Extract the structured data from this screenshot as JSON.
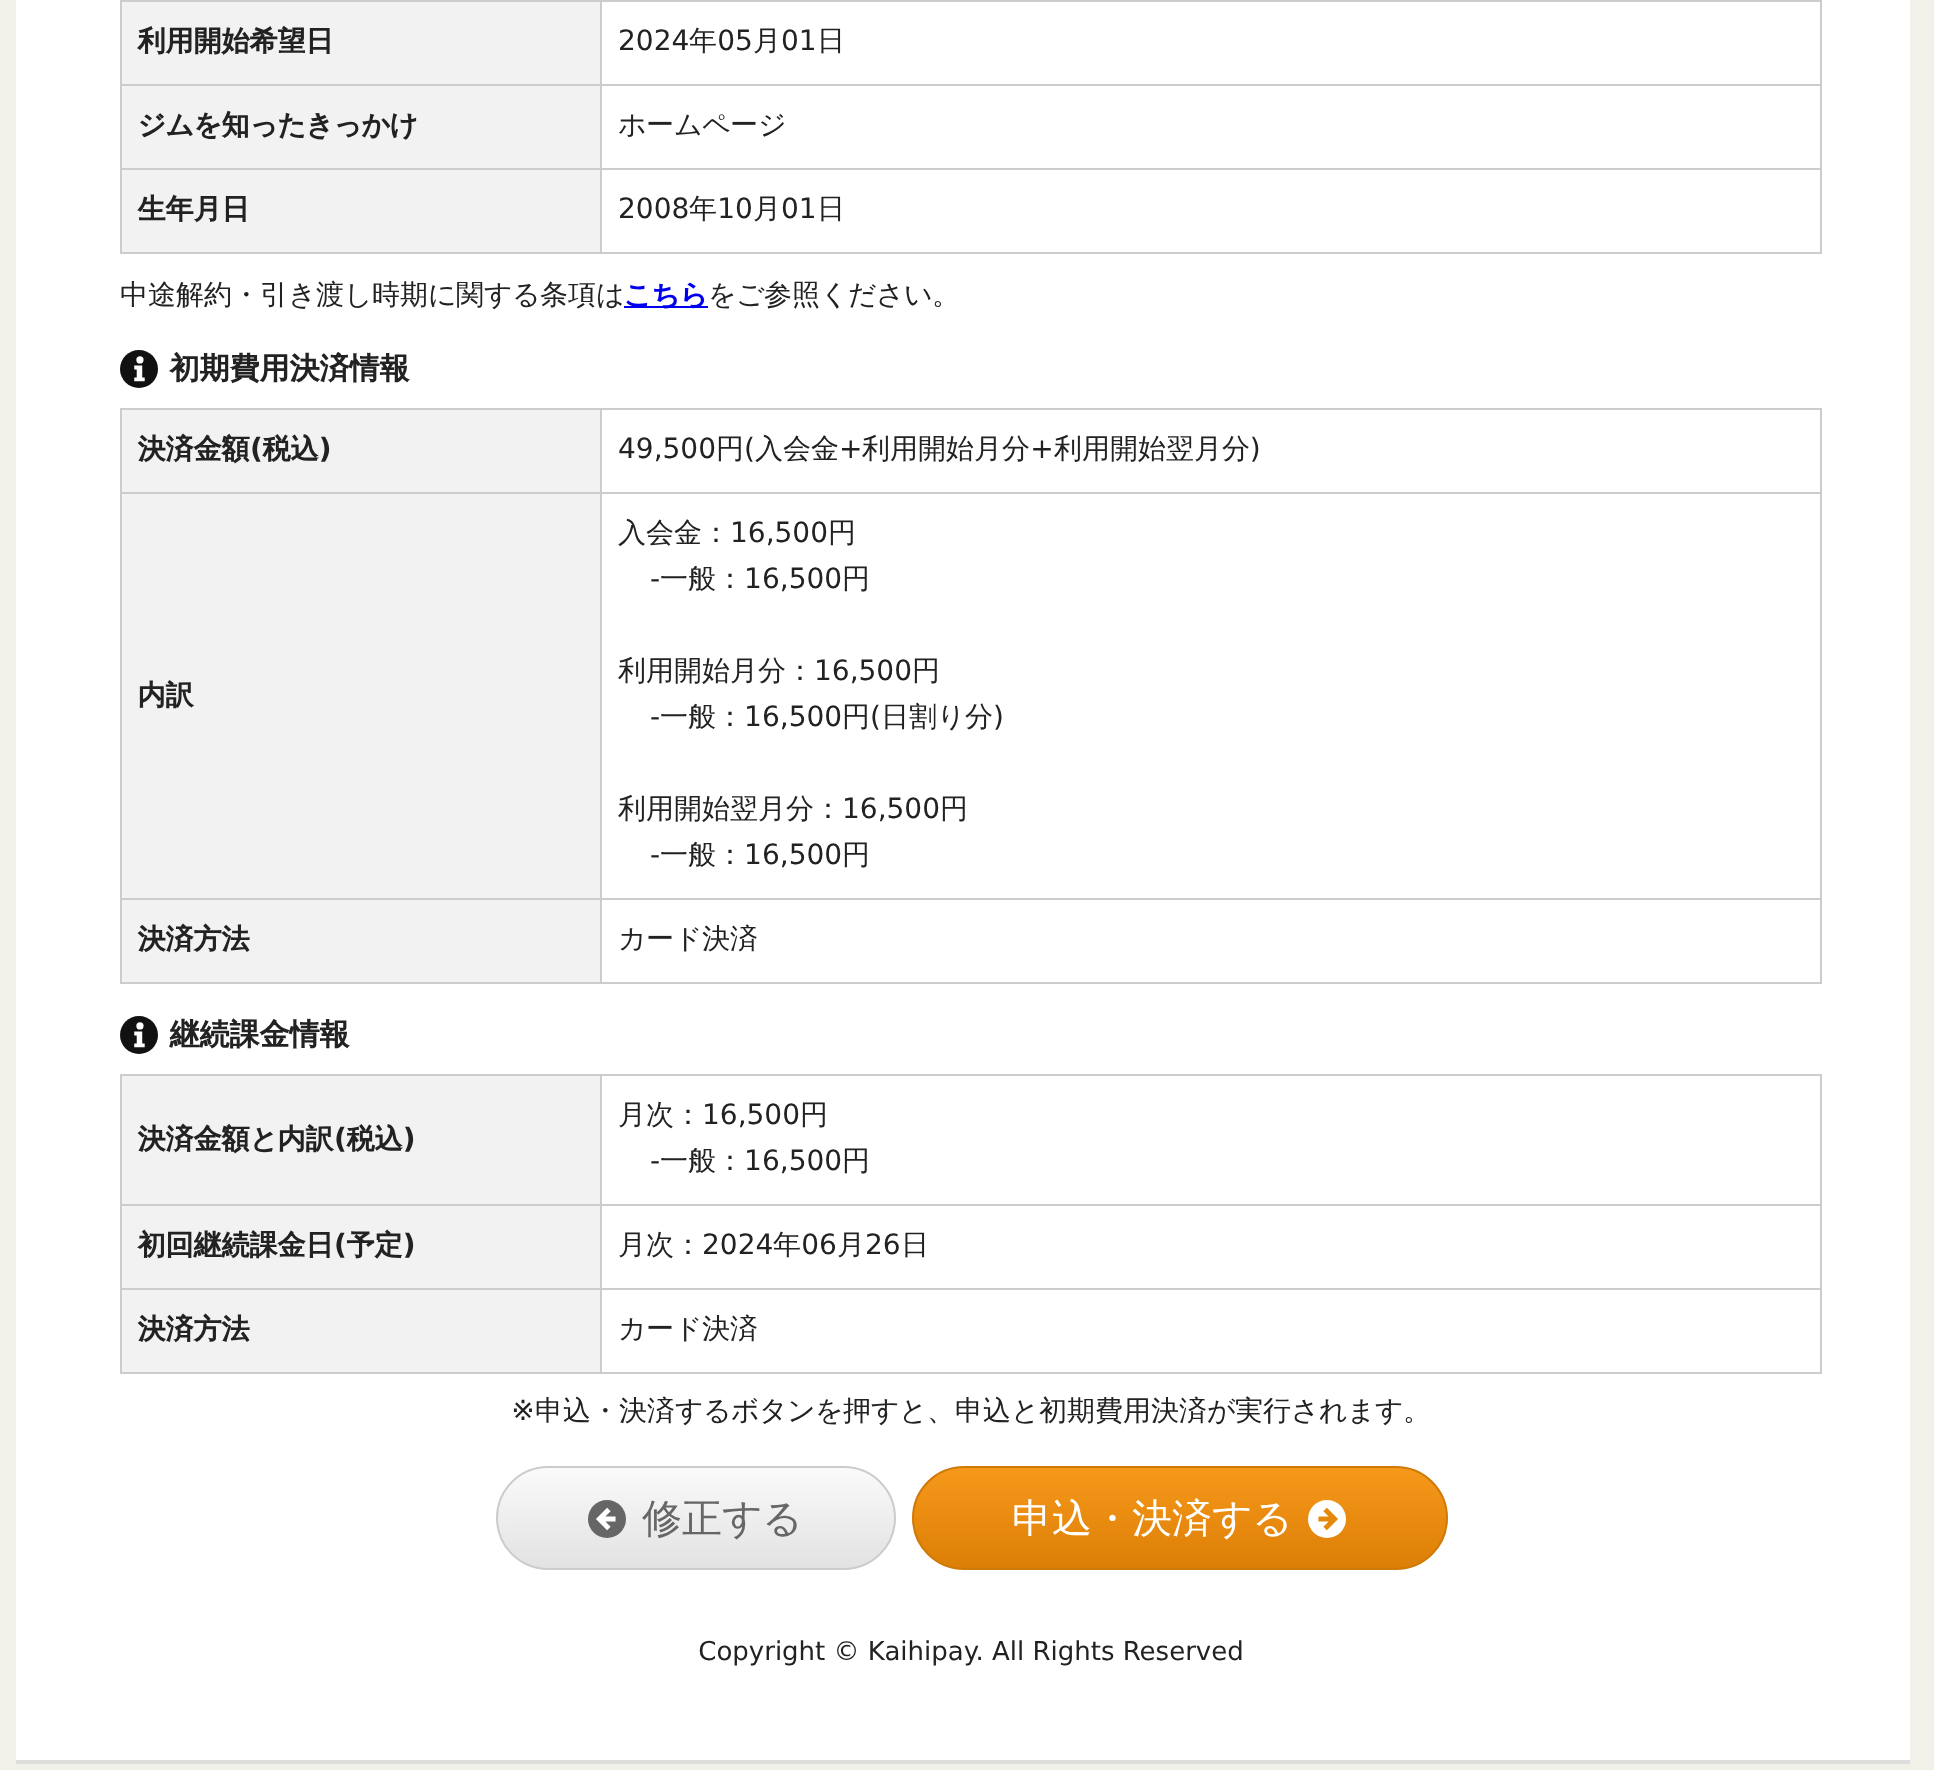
{
  "applicant_table": [
    {
      "label": "利用開始希望日",
      "lines": [
        {
          "text": "2024年05月01日"
        }
      ]
    },
    {
      "label": "ジムを知ったきっかけ",
      "lines": [
        {
          "text": "ホームページ"
        }
      ]
    },
    {
      "label": "生年月日",
      "lines": [
        {
          "text": "2008年10月01日"
        }
      ]
    }
  ],
  "notice": {
    "before": "中途解約・引き渡し時期に関する条項は",
    "link": "こちら",
    "after": "をご参照ください。"
  },
  "sections": [
    {
      "title": "初期費用決済情報",
      "rows": [
        {
          "label": "決済金額(税込)",
          "lines": [
            {
              "text": "49,500円(入会金+利用開始月分+利用開始翌月分)"
            }
          ]
        },
        {
          "label": "内訳",
          "lines": [
            {
              "text": "入会金：16,500円",
              "children": [
                {
                  "text": "-一般：16,500円"
                }
              ]
            },
            {
              "text": "利用開始月分：16,500円",
              "children": [
                {
                  "text": "-一般：16,500円(日割り分)"
                }
              ]
            },
            {
              "text": "利用開始翌月分：16,500円",
              "children": [
                {
                  "text": "-一般：16,500円"
                }
              ]
            }
          ]
        },
        {
          "label": "決済方法",
          "lines": [
            {
              "text": "カード決済"
            }
          ]
        }
      ]
    },
    {
      "title": "継続課金情報",
      "rows": [
        {
          "label": "決済金額と内訳(税込)",
          "lines": [
            {
              "text": "月次：16,500円",
              "children": [
                {
                  "text": "-一般：16,500円"
                }
              ]
            }
          ]
        },
        {
          "label": "初回継続課金日(予定)",
          "lines": [
            {
              "text": "月次：2024年06月26日"
            }
          ]
        },
        {
          "label": "決済方法",
          "lines": [
            {
              "text": "カード決済"
            }
          ]
        }
      ]
    }
  ],
  "submit_note": "※申込・決済するボタンを押すと、申込と初期費用決済が実行されます。",
  "buttons": [
    {
      "kind": "back",
      "label": "修正する"
    },
    {
      "kind": "submit",
      "label": "申込・決済する"
    }
  ],
  "copyright": "Copyright © Kaihipay. All Rights Reserved"
}
